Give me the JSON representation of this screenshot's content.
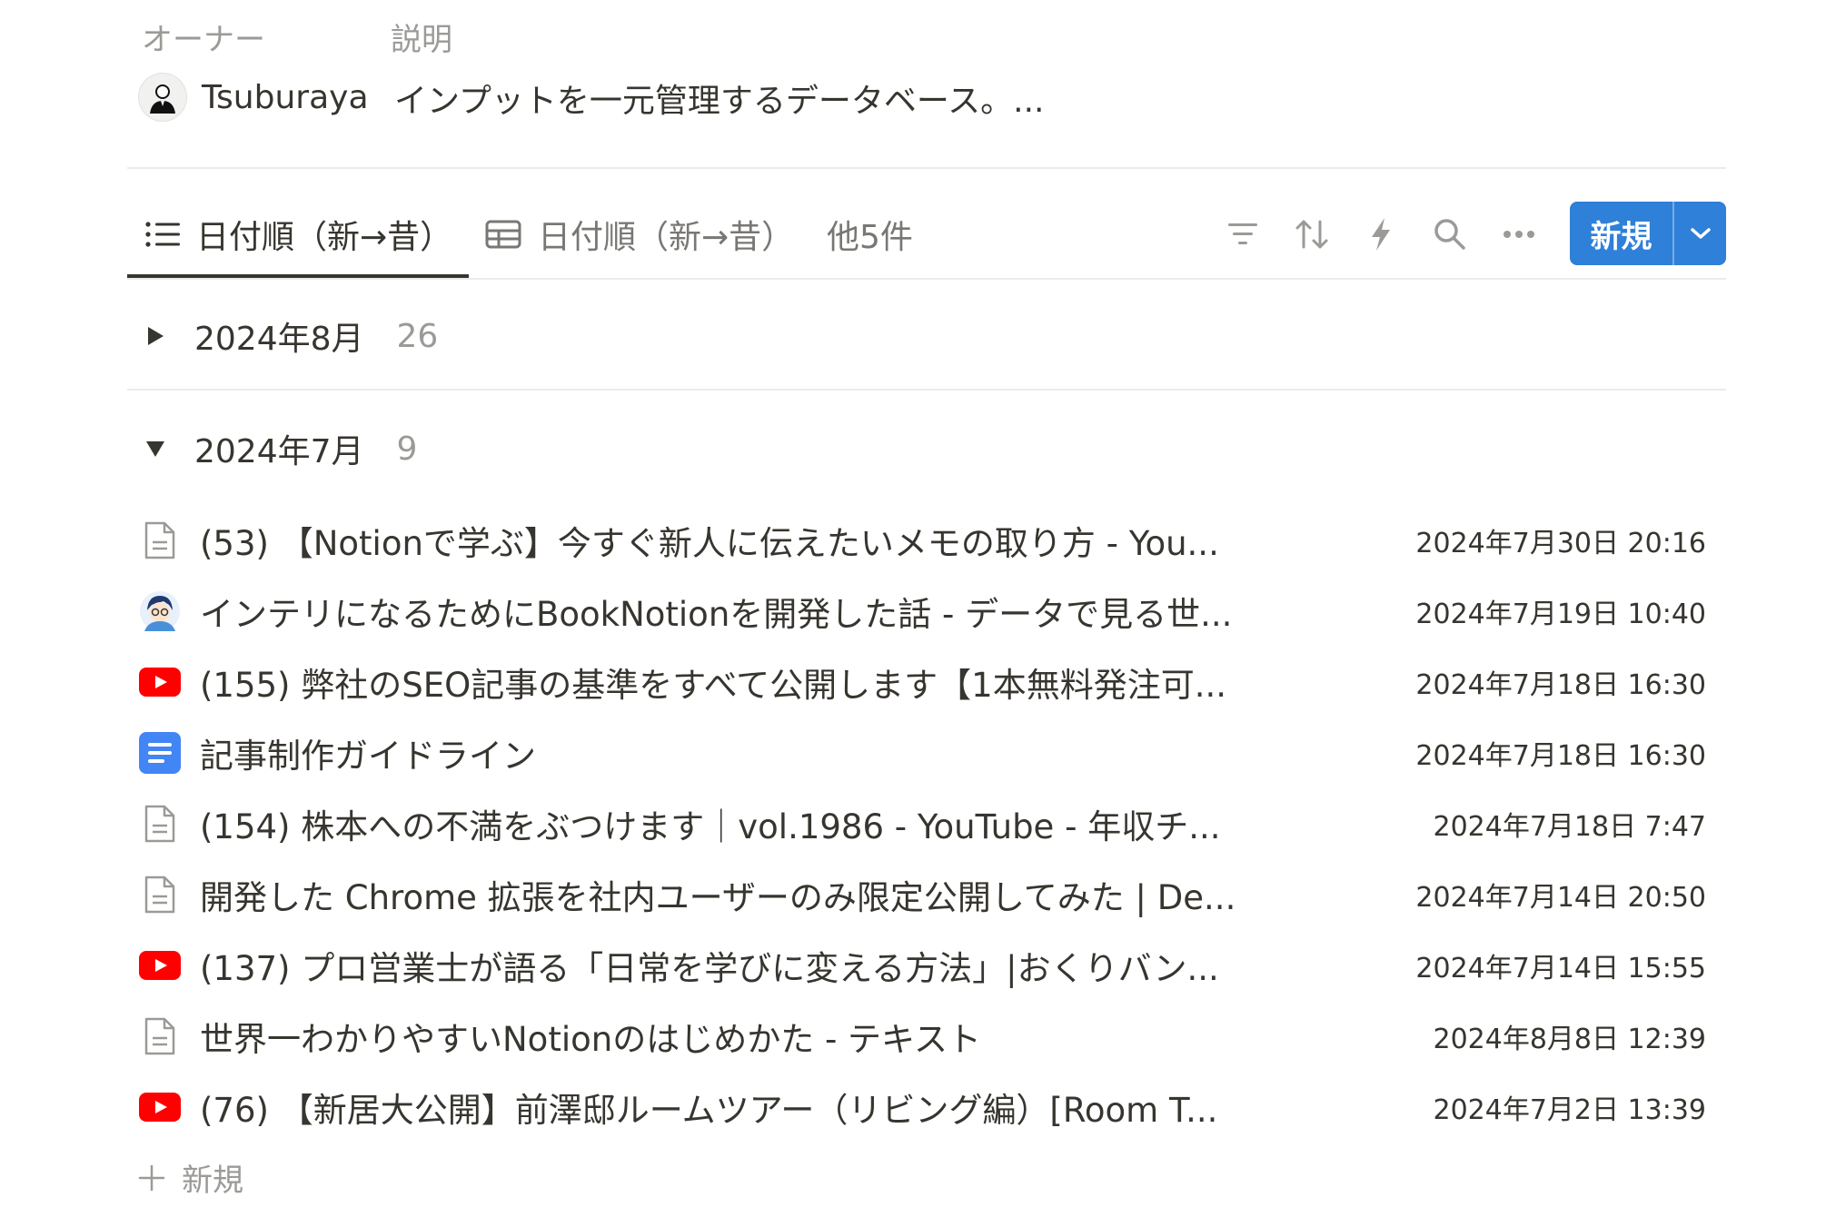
{
  "properties": {
    "owner_label": "オーナー",
    "description_label": "説明",
    "owner_name": "Tsuburaya",
    "description": "インプットを一元管理するデータベース。..."
  },
  "views": {
    "tabs": [
      {
        "label": "日付順（新→昔）",
        "icon": "list-icon",
        "active": true
      },
      {
        "label": "日付順（新→昔）",
        "icon": "table-icon",
        "active": false
      }
    ],
    "more_label": "他5件"
  },
  "toolbar": {
    "new_label": "新規",
    "accent": "#2f80d8",
    "icons": [
      "filter-icon",
      "sort-icon",
      "automation-icon",
      "search-icon",
      "more-icon"
    ]
  },
  "groups": [
    {
      "label": "2024年8月",
      "count": "26",
      "expanded": false
    },
    {
      "label": "2024年7月",
      "count": "9",
      "expanded": true
    }
  ],
  "rows": [
    {
      "icon": "page-icon",
      "title": "(53) 【Notionで学ぶ】今すぐ新人に伝えたいメモの取り方 - You...",
      "date": "2024年7月30日 20:16"
    },
    {
      "icon": "avatar-icon",
      "title": "インテリになるためにBookNotionを開発した話 - データで見る世...",
      "date": "2024年7月19日 10:40"
    },
    {
      "icon": "youtube-icon",
      "title": "(155) 弊社のSEO記事の基準をすべて公開します【1本無料発注可...",
      "date": "2024年7月18日 16:30"
    },
    {
      "icon": "google-docs-icon",
      "title": "記事制作ガイドライン",
      "date": "2024年7月18日 16:30"
    },
    {
      "icon": "page-icon",
      "title": "(154) 株本への不満をぶつけます｜vol.1986 - YouTube - 年収チ...",
      "date": "2024年7月18日 7:47"
    },
    {
      "icon": "page-icon",
      "title": "開発した Chrome 拡張を社内ユーザーのみ限定公開してみた | De...",
      "date": "2024年7月14日 20:50"
    },
    {
      "icon": "youtube-icon",
      "title": "(137) プロ営業士が語る「日常を学びに変える方法」|おくりバン...",
      "date": "2024年7月14日 15:55"
    },
    {
      "icon": "page-icon",
      "title": "世界一わかりやすいNotionのはじめかた - テキスト",
      "date": "2024年8月8日 12:39"
    },
    {
      "icon": "youtube-icon",
      "title": "(76) 【新居大公開】前澤邸ルームツアー（リビング編）[Room T...",
      "date": "2024年7月2日 13:39"
    }
  ],
  "add_new_label": "新規"
}
